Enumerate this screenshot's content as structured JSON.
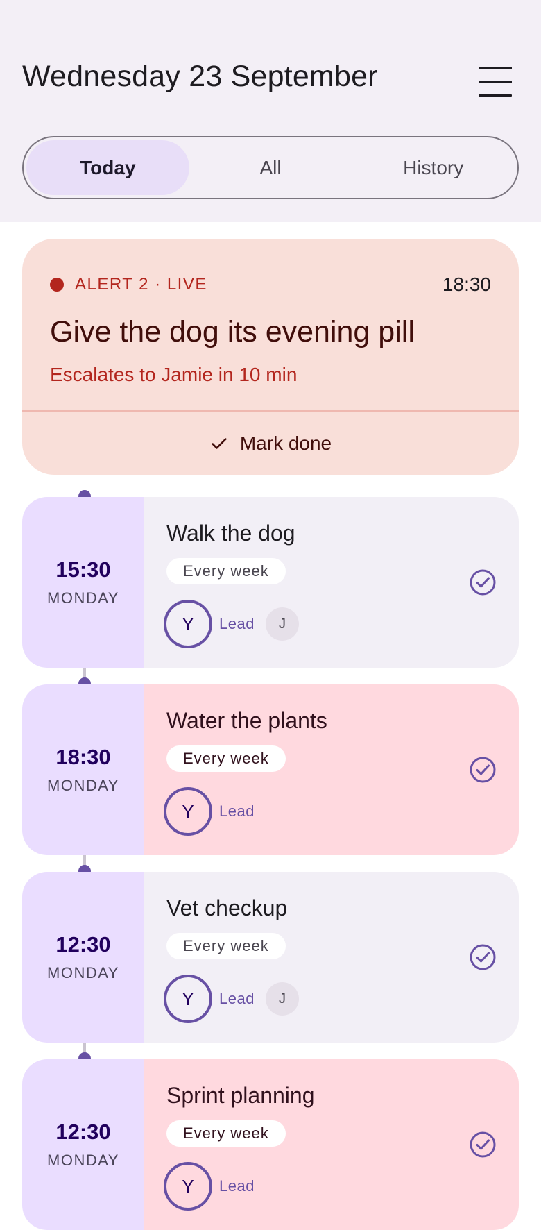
{
  "header": {
    "title": "Wednesday 23 September",
    "tabs": [
      "Today",
      "All",
      "History"
    ],
    "active_tab": "Today"
  },
  "alert": {
    "label": "ALERT 2 · LIVE",
    "time": "18:30",
    "title": "Give the dog its evening pill",
    "subtitle": "Escalates to Jamie in 10 min",
    "action": "Mark done"
  },
  "tasks": [
    {
      "time": "15:30",
      "day": "MONDAY",
      "title": "Walk the dog",
      "recurrence": "Every week",
      "owner": "Y",
      "role": "Lead",
      "other": "J"
    },
    {
      "time": "18:30",
      "day": "MONDAY",
      "title": "Water the plants",
      "recurrence": "Every week",
      "owner": "Y",
      "role": "Lead"
    },
    {
      "time": "12:30",
      "day": "MONDAY",
      "title": "Vet checkup",
      "recurrence": "Every week",
      "owner": "Y",
      "role": "Lead",
      "other": "J"
    },
    {
      "time": "12:30",
      "day": "MONDAY",
      "title": "Sprint planning",
      "recurrence": "Every week",
      "owner": "Y",
      "role": "Lead"
    }
  ],
  "colors": {
    "accent": "#6750a4",
    "alert": "#b3261e",
    "alert_bg": "#f9dfd9",
    "pink_bg": "#ffd9df",
    "neutral_bg": "#f2eff6",
    "time_bg": "#eaddff"
  },
  "icons": {
    "menu": "menu-icon",
    "check": "check-icon",
    "complete": "check-circle-icon"
  }
}
